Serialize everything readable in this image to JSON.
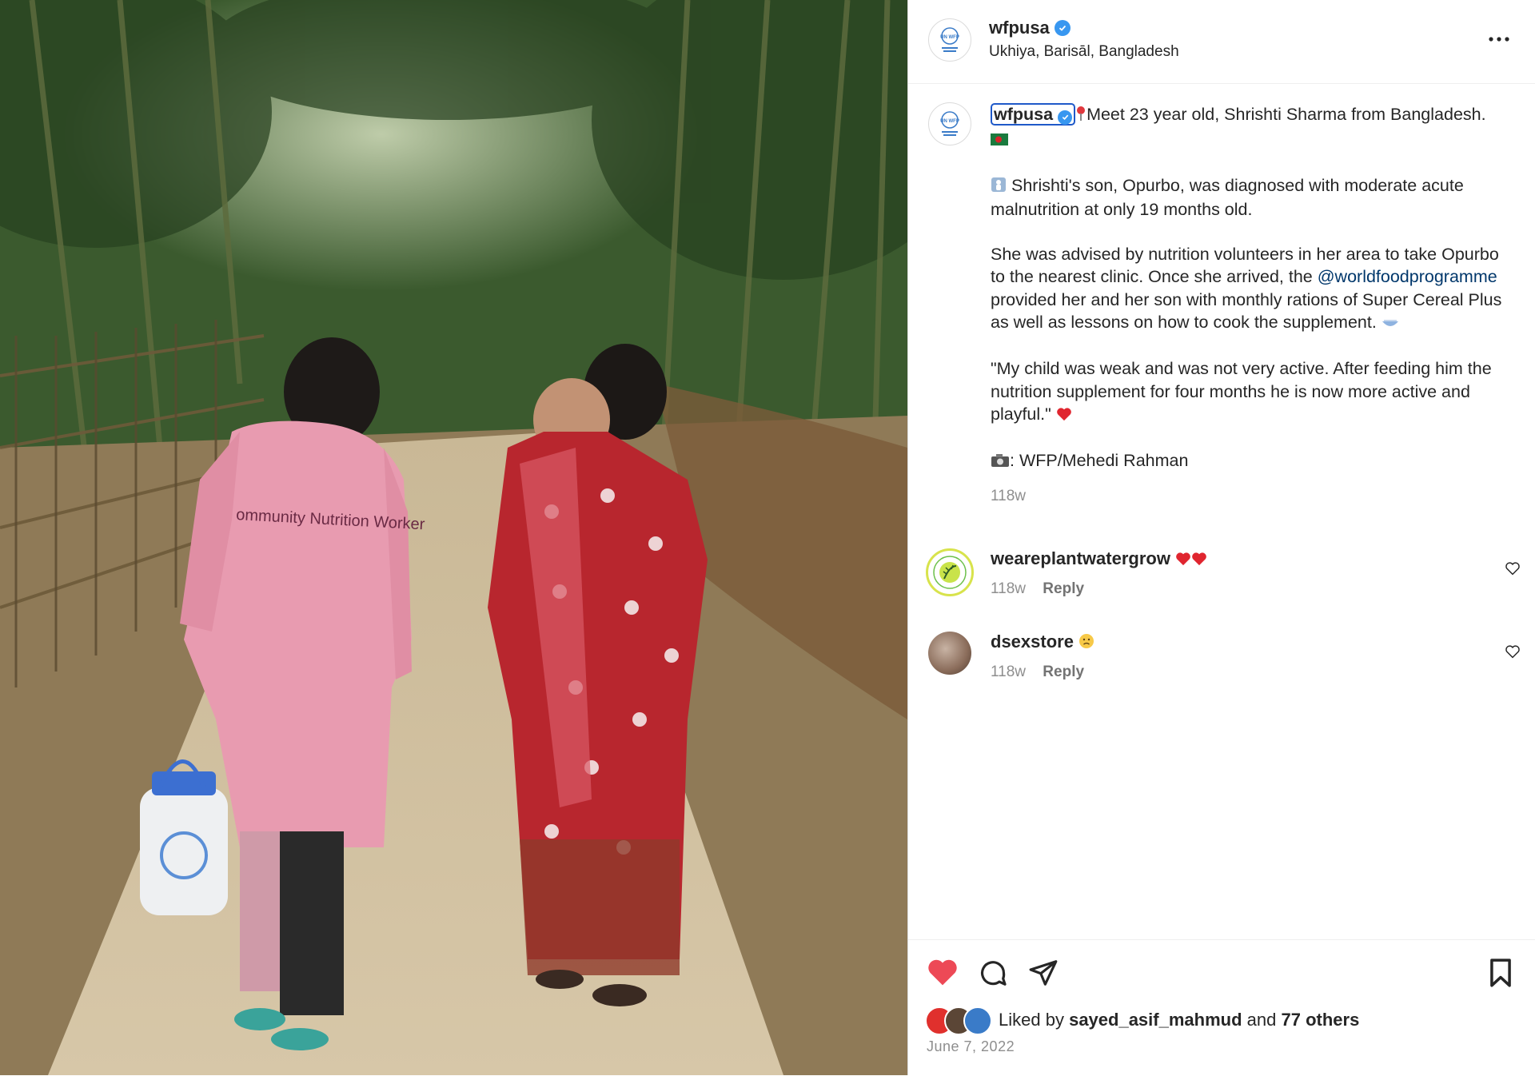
{
  "post": {
    "username": "wfpusa",
    "location": "Ukhiya, Barisāl, Bangladesh",
    "avatar_label": "UN WFP"
  },
  "caption": {
    "username": "wfpusa",
    "line1": "Meet 23 year old, Shrishti Sharma from Bangladesh.",
    "line2": "Shrishti's son, Opurbo, was diagnosed with moderate acute malnutrition at only 19 months old.",
    "line3_before": "She was advised by nutrition volunteers in her area to take Opurbo to the nearest clinic. Once she arrived, the ",
    "mention": "@worldfoodprogramme",
    "line3_after": " provided her and her son with monthly rations of Super Cereal Plus as well as lessons on how to cook the supplement.",
    "line4": "\"My child was weak and was not very active. After feeding him the nutrition supplement for four months he is now more active and playful.\"",
    "line5": ": WFP/Mehedi Rahman",
    "time": "118w"
  },
  "comments": [
    {
      "username": "weareplantwatergrow",
      "time": "118w",
      "reply": "Reply"
    },
    {
      "username": "dsexstore",
      "time": "118w",
      "reply": "Reply"
    }
  ],
  "likes": {
    "prefix": "Liked by",
    "user": "sayed_asif_mahmud",
    "middle": "and",
    "others": "77 others"
  },
  "date": "June 7, 2022",
  "colors": {
    "verified": "#3897f0",
    "liked_heart": "#ed4956",
    "mention": "#00376b",
    "highlight_border": "#1f59c9"
  },
  "icons": [
    "verified-icon",
    "more-options-icon",
    "like-icon",
    "comment-icon",
    "share-icon",
    "save-icon",
    "comment-like-icon"
  ],
  "image": {
    "description": "Photo of a community nutrition worker in a pink coat and a mother carrying a child walking down a dirt path through bamboo forest"
  }
}
